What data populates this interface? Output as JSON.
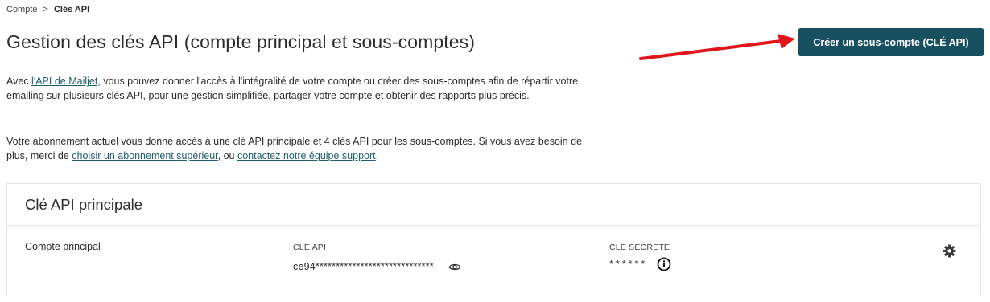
{
  "breadcrumb": {
    "parent": "Compte",
    "separator": ">",
    "current": "Clés API"
  },
  "header": {
    "title": "Gestion des clés API (compte principal et sous-comptes)",
    "create_button_label": "Créer un sous-compte (CLÉ API)"
  },
  "intro": {
    "p1_before": "Avec ",
    "p1_link": "l'API de Mailjet",
    "p1_after": ", vous pouvez donner l'accès à l'intégralité de votre compte ou créer des sous-comptes afin de répartir votre emailing sur plusieurs clés API, pour une gestion simplifiée, partager votre compte et obtenir des rapports plus précis.",
    "p2_before": "Votre abonnement actuel vous donne accès à une clé API principale et 4 clés API pour les sous-comptes. Si vous avez besoin de plus, merci de ",
    "p2_link1": "choisir un abonnement supérieur",
    "p2_middle": ", ou ",
    "p2_link2": "contactez notre équipe support",
    "p2_after": "."
  },
  "main_key_card": {
    "title": "Clé API principale",
    "account_name": "Compte principal",
    "api_key_label": "CLÉ API",
    "api_key_value": "ce94*****************************",
    "secret_key_label": "CLÉ SECRÈTE",
    "secret_key_value": "******"
  },
  "icons": {
    "eye": "eye-icon",
    "info": "info-icon",
    "gear": "gear-icon"
  },
  "colors": {
    "primary_button": "#17505e",
    "link": "#1f5f6e",
    "annotation_arrow": "#e0161c"
  }
}
